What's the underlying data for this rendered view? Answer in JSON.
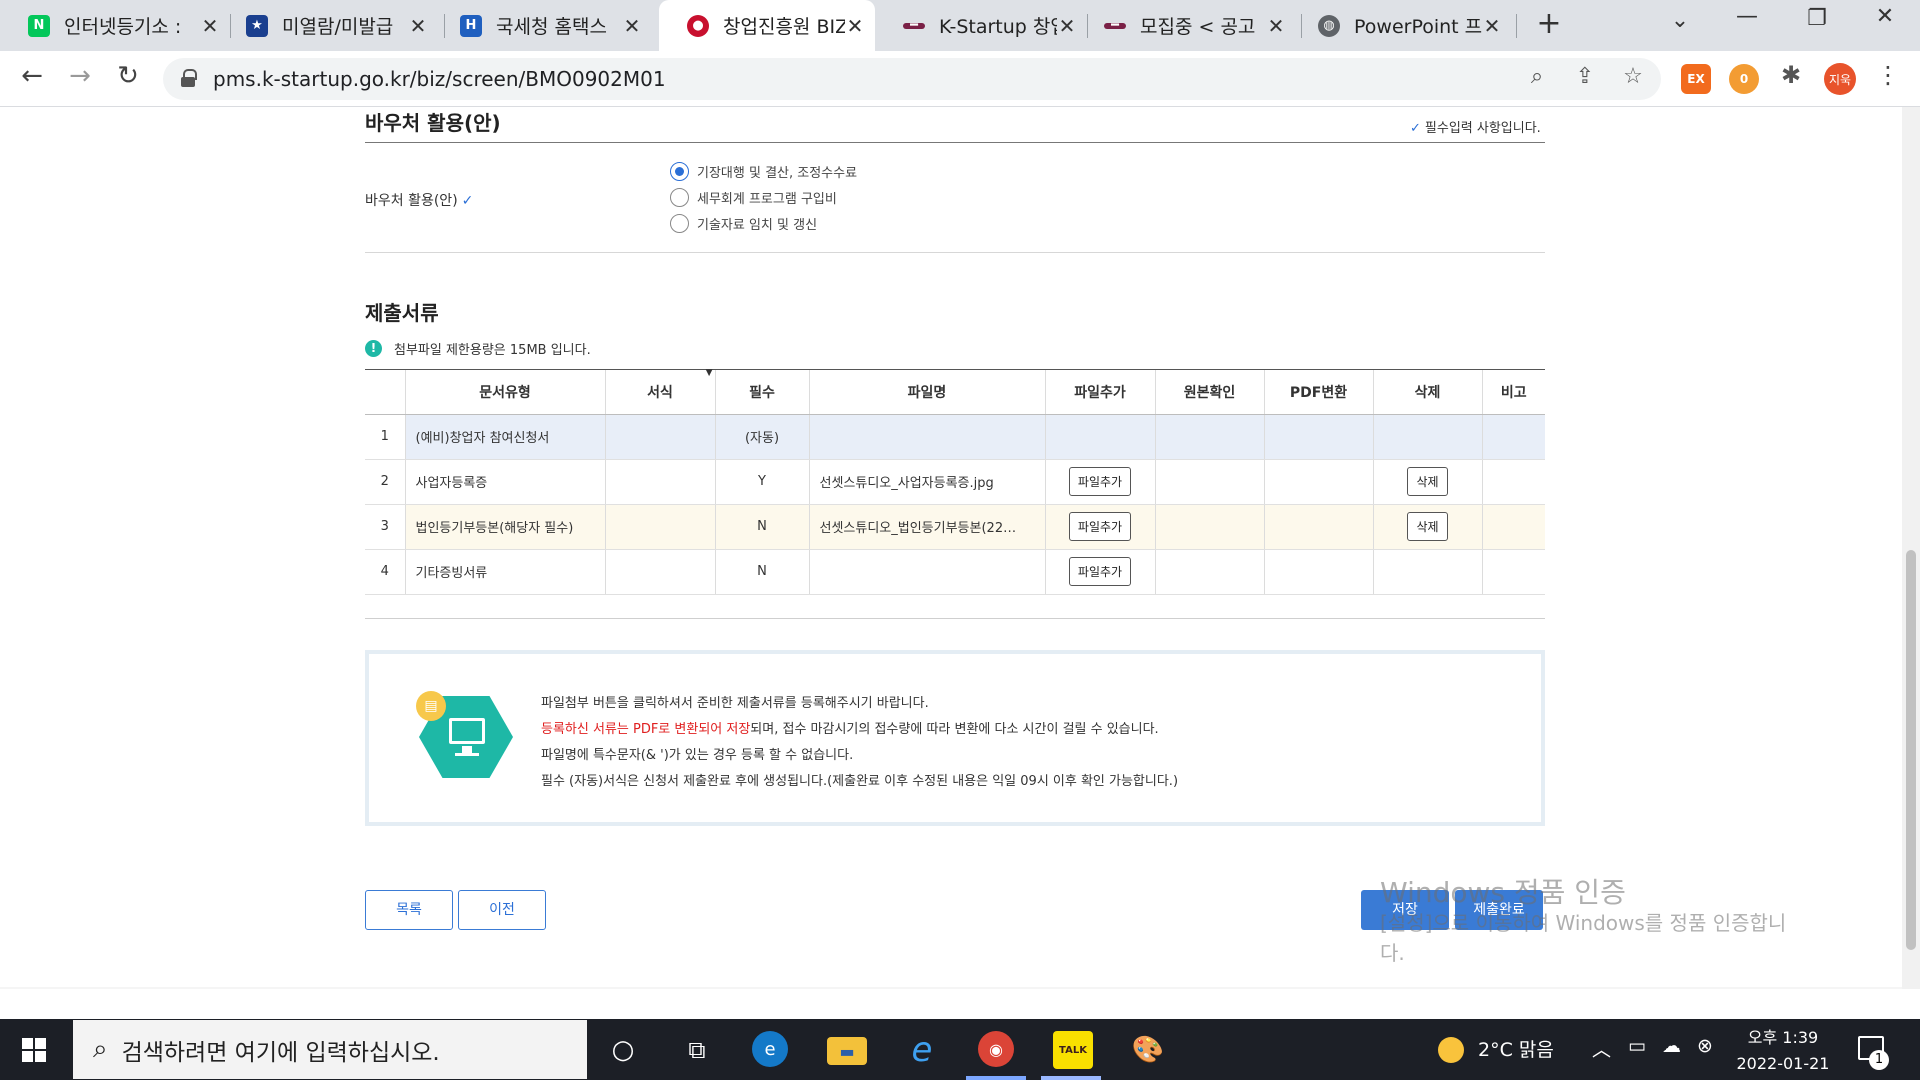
{
  "browser": {
    "tabs": [
      {
        "title": "인터넷등기소 :",
        "favicon": "N",
        "color": "#03c75a"
      },
      {
        "title": "미열람/미발급",
        "favicon": "★",
        "color": "#1a3f8f"
      },
      {
        "title": "국세청 홈택스",
        "favicon": "H",
        "color": "#1f5fbf"
      },
      {
        "title": "창업진흥원 BIZ",
        "favicon": "●",
        "color": "#c8102e"
      },
      {
        "title": "K-Startup 창업",
        "favicon": "━",
        "color": "#7a2046"
      },
      {
        "title": "모집중 < 공고",
        "favicon": "━",
        "color": "#7a2046"
      },
      {
        "title": "PowerPoint 프",
        "favicon": "◍",
        "color": "#5f6368"
      }
    ],
    "new_tab": "+",
    "url": "pms.k-startup.go.kr/biz/screen/BMO0902M01",
    "extensions": [
      {
        "label": "EX",
        "color": "#f26b1d"
      },
      {
        "label": "0",
        "color": "#f39c33"
      }
    ],
    "profile_label": "지욱"
  },
  "voucher": {
    "section_title": "바우처 활용(안)",
    "required_note": "필수입력 사항입니다.",
    "field_label": "바우처 활용(안)",
    "options": [
      {
        "label": "기장대행 및 결산, 조정수수료",
        "selected": true
      },
      {
        "label": "세무회계 프로그램 구입비",
        "selected": false
      },
      {
        "label": "기술자료 임치 및 갱신",
        "selected": false
      }
    ]
  },
  "docs": {
    "section_title": "제출서류",
    "notice": "첨부파일 제한용량은 15MB 입니다.",
    "columns": [
      "",
      "문서유형",
      "서식",
      "필수",
      "파일명",
      "파일추가",
      "원본확인",
      "PDF변환",
      "삭제",
      "비고"
    ],
    "rows": [
      {
        "no": "1",
        "type": "(예비)창업자 참여신청서",
        "form": "",
        "required": "(자동)",
        "filename": "",
        "add": "",
        "delete": ""
      },
      {
        "no": "2",
        "type": "사업자등록증",
        "form": "",
        "required": "Y",
        "filename": "선셋스튜디오_사업자등록증.jpg",
        "add": "파일추가",
        "delete": "삭제"
      },
      {
        "no": "3",
        "type": "법인등기부등본(해당자 필수)",
        "form": "",
        "required": "N",
        "filename": "선셋스튜디오_법인등기부등본(22…",
        "add": "파일추가",
        "delete": "삭제"
      },
      {
        "no": "4",
        "type": "기타증빙서류",
        "form": "",
        "required": "N",
        "filename": "",
        "add": "파일추가",
        "delete": ""
      }
    ]
  },
  "guide": {
    "line1": "파일첨부 버튼을 클릭하셔서 준비한 제출서류를 등록해주시기 바랍니다.",
    "line2_red": "등록하신 서류는 PDF로 변환되어 저장",
    "line2_rest": "되며, 접수 마감시기의 접수량에 따라 변환에 다소 시간이 걸릴 수 있습니다.",
    "line3": "파일명에 특수문자(& ')가 있는 경우 등록 할 수 없습니다.",
    "line4": "필수 (자동)서식은 신청서 제출완료 후에 생성됩니다.(제출완료 이후 수정된 내용은 익일 09시 이후 확인 가능합니다.)"
  },
  "buttons": {
    "list": "목록",
    "prev": "이전",
    "save": "저장",
    "submit": "제출완료"
  },
  "watermark": {
    "title": "Windows 정품 인증",
    "line1": "[설정]으로 이동하여 Windows를 정품 인증합니",
    "line2": "다."
  },
  "taskbar": {
    "search_placeholder": "검색하려면 여기에 입력하십시오.",
    "weather": "2°C  맑음",
    "time": "오후 1:39",
    "date": "2022-01-21",
    "notification_count": "1",
    "kakao_label": "TALK"
  }
}
